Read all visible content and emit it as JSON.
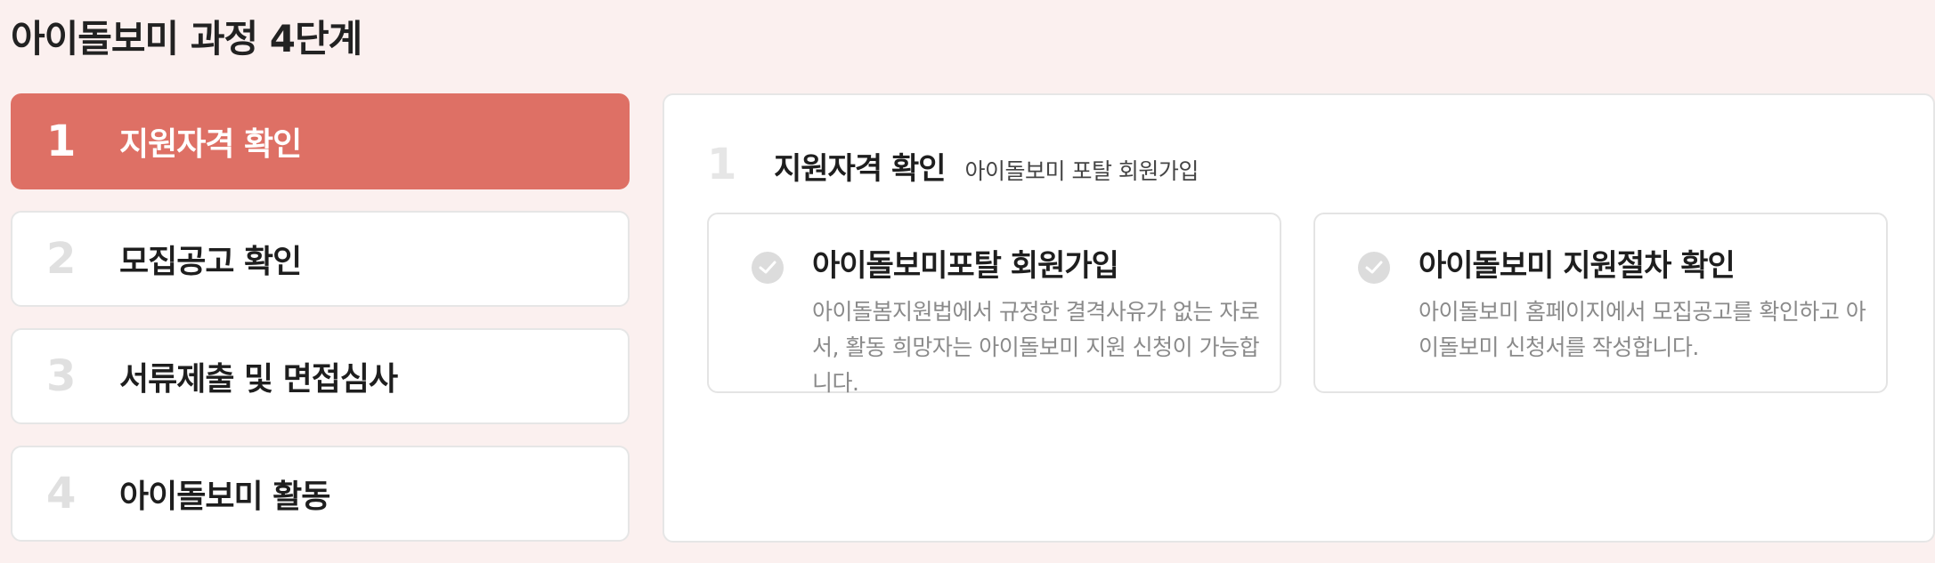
{
  "page": {
    "title": "아이돌보미 과정 4단계"
  },
  "steps": [
    {
      "num": "1",
      "label": "지원자격 확인",
      "active": true
    },
    {
      "num": "2",
      "label": "모집공고 확인",
      "active": false
    },
    {
      "num": "3",
      "label": "서류제출 및 면접심사",
      "active": false
    },
    {
      "num": "4",
      "label": "아이돌보미 활동",
      "active": false
    }
  ],
  "panel": {
    "num": "1",
    "title": "지원자격 확인",
    "subtitle": "아이돌보미 포탈 회원가입",
    "cards": [
      {
        "icon": "check-circle-icon",
        "title": "아이돌보미포탈 회원가입",
        "desc": "아이돌봄지원법에서 규정한 결격사유가 없는 자로서, 활동 희망자는 아이돌보미 지원 신청이 가능합니다."
      },
      {
        "icon": "check-circle-icon",
        "title": "아이돌보미 지원절차 확인",
        "desc": "아이돌보미 홈페이지에서 모집공고를 확인하고 아이돌보미 신청서를 작성합니다."
      }
    ]
  },
  "colors": {
    "background": "#fbf0ef",
    "accent": "#de7065",
    "step_number_inactive": "#e0e0e0",
    "check_icon": "#dcdcdc"
  }
}
